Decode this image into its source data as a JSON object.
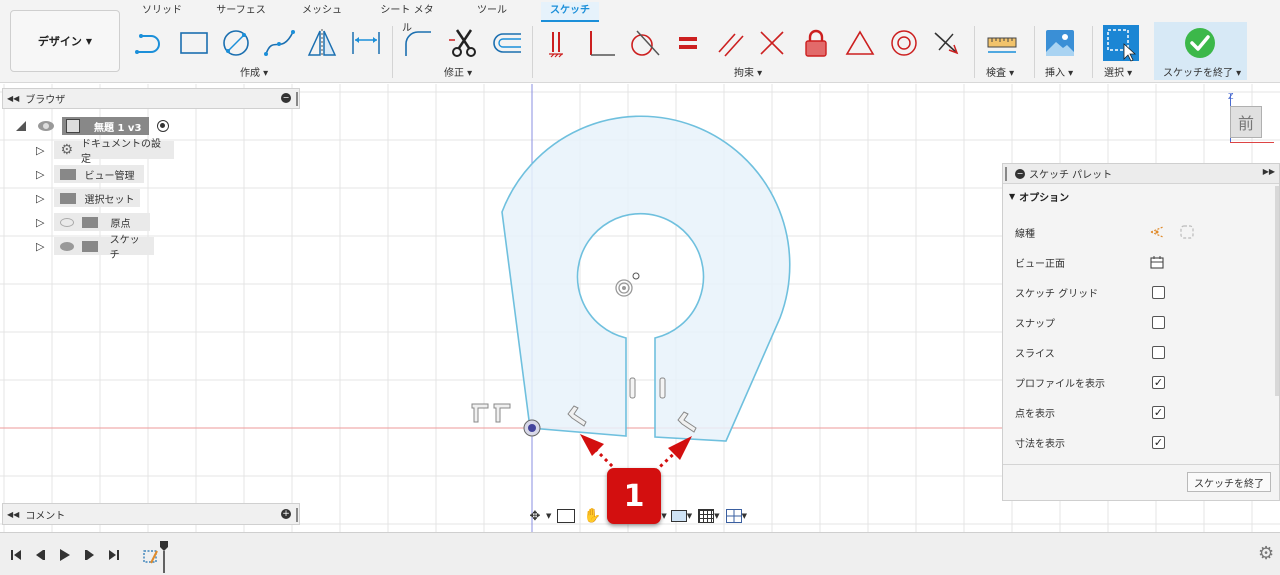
{
  "toolbar": {
    "design_label": "デザイン",
    "tabs": [
      "ソリッド",
      "サーフェス",
      "メッシュ",
      "シート メタル",
      "ツール",
      "スケッチ"
    ],
    "groups": {
      "create": "作成",
      "modify": "修正",
      "constrain": "拘束",
      "inspect": "検査",
      "insert": "挿入",
      "select": "選択",
      "finish": "スケッチを終了"
    }
  },
  "browser": {
    "title": "ブラウザ",
    "root_label": "無題 1  v3",
    "items": [
      {
        "label": "ドキュメントの設定",
        "icon": "gear-icon"
      },
      {
        "label": "ビュー管理",
        "icon": "folder-icon"
      },
      {
        "label": "選択セット",
        "icon": "folder-icon"
      },
      {
        "label": "原点",
        "icon": "folder-icon"
      },
      {
        "label": "スケッチ",
        "icon": "folder-icon"
      }
    ]
  },
  "comment": {
    "title": "コメント"
  },
  "viewcube": {
    "face": "前",
    "axis": "Z"
  },
  "palette": {
    "title": "スケッチ パレット",
    "section": "オプション",
    "rows": [
      {
        "label": "線種",
        "control": "icon"
      },
      {
        "label": "ビュー正面",
        "control": "icon"
      },
      {
        "label": "スケッチ グリッド",
        "checked": false
      },
      {
        "label": "スナップ",
        "checked": false
      },
      {
        "label": "スライス",
        "checked": false
      },
      {
        "label": "プロファイルを表示",
        "checked": true
      },
      {
        "label": "点を表示",
        "checked": true
      },
      {
        "label": "寸法を表示",
        "checked": true
      }
    ],
    "finish_button": "スケッチを終了"
  },
  "annotation": {
    "badge": "1"
  },
  "colors": {
    "accent": "#1b8fd9",
    "sketch_line": "#6fc0de",
    "profile_fill": "#e8f2fa",
    "badge_red": "#d30f0f",
    "tool_red": "#cc1f1f"
  }
}
